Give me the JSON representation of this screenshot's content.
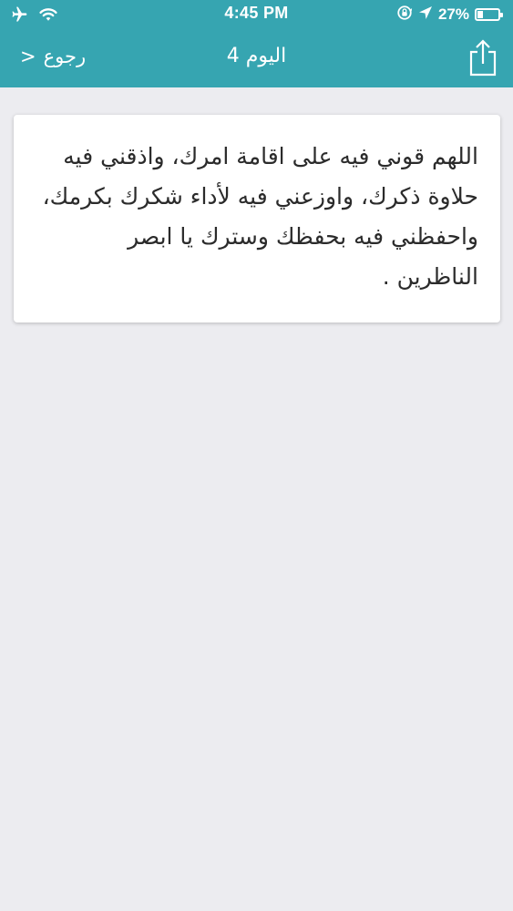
{
  "status_bar": {
    "time": "4:45 PM",
    "battery_percent": "27%",
    "battery_level": 0.27,
    "icons": [
      "airplane-icon",
      "wifi-icon",
      "rotation-lock-icon",
      "location-arrow-icon",
      "battery-icon"
    ]
  },
  "nav": {
    "back_label": "رجوع",
    "back_chevron": ">",
    "title": "اليوم 4",
    "share_icon": "share-icon"
  },
  "card": {
    "text": "اللهم قوني فيه على اقامة امرك، واذقني فيه حلاوة ذكرك، واوزعني فيه لأداء شكرك بكرمك، واحفظني فيه بحفظك وسترك يا ابصر الناظرين ."
  },
  "colors": {
    "header": "#36a5b1",
    "background": "#ececf0",
    "card": "#ffffff",
    "text": "#2b2b2b"
  }
}
